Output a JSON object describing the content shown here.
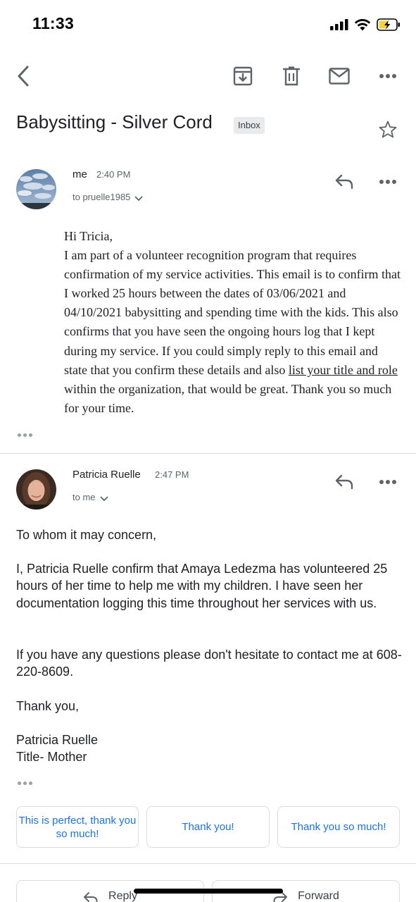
{
  "status_bar": {
    "time": "11:33"
  },
  "toolbar": {
    "back_icon": "chevron-left-icon",
    "archive_icon": "archive-icon",
    "delete_icon": "trash-icon",
    "mark_unread_icon": "envelope-icon",
    "more_icon": "more-horizontal-icon"
  },
  "thread": {
    "subject": "Babysitting  - Silver Cord",
    "label": "Inbox",
    "star_icon": "star-outline-icon"
  },
  "messages": [
    {
      "sender": "me",
      "time": "2:40 PM",
      "to": "to pruelle1985",
      "body_lines": {
        "line1": "Hi Tricia,",
        "line2": "I am part of a volunteer recognition program that requires confirmation of my service activities. This email is to confirm that I worked 25 hours between the dates of 03/06/2021 and 04/10/2021 babysitting and spending time with the kids. This also confirms that you have seen the ongoing hours log that I kept during my service. If you could simply reply to this email and state that you confirm these details and also ",
        "link_text": "list your title and role ",
        "line3": "within the organization, that would be great. Thank you so much for your time."
      }
    },
    {
      "sender": "Patricia Ruelle",
      "time": "2:47 PM",
      "to": "to me",
      "paragraphs": [
        "To whom it may concern,",
        "I, Patricia Ruelle confirm that Amaya Ledezma has volunteered 25 hours of her time to help me with my children. I have seen her documentation logging this time throughout her services with us.",
        "If you have any questions please don't hesitate to contact me at 608-220-8609.",
        "Thank you,",
        "Patricia Ruelle\nTitle- Mother"
      ]
    }
  ],
  "smart_replies": [
    "This is perfect, thank you so much!",
    "Thank you!",
    "Thank you so much!"
  ],
  "actions": {
    "reply": "Reply",
    "forward": "Forward"
  },
  "colors": {
    "accent": "#1a73e8",
    "text": "#202124",
    "muted": "#5f6368"
  }
}
